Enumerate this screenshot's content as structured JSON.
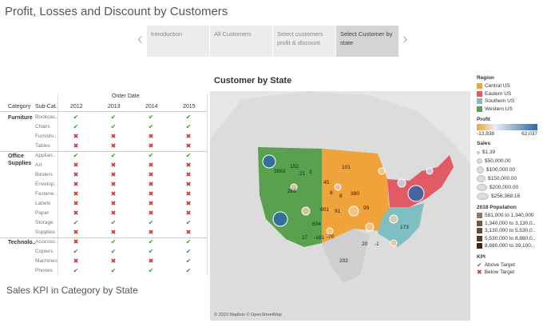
{
  "page_title": "Profit, Losses and Discount by Customers",
  "story": {
    "tabs": [
      "Introduction",
      "All Customers",
      "Select customers profit & discount",
      "Select Customer by state"
    ],
    "active_index": 3
  },
  "table": {
    "header_order_date": "Order Date",
    "col_category": "Category",
    "col_subcategory": "Sub-Cat..",
    "years": [
      "2012",
      "2013",
      "2014",
      "2015"
    ],
    "groups": [
      {
        "category": "Furniture",
        "rows": [
          {
            "sub": "Bookcas..",
            "kpi": [
              1,
              1,
              1,
              1
            ]
          },
          {
            "sub": "Chairs",
            "kpi": [
              1,
              1,
              1,
              1
            ]
          },
          {
            "sub": "Furnishi..",
            "kpi": [
              0,
              0,
              0,
              0
            ]
          },
          {
            "sub": "Tables",
            "kpi": [
              0,
              0,
              0,
              0
            ]
          }
        ]
      },
      {
        "category": "Office Supplies",
        "rows": [
          {
            "sub": "Applian..",
            "kpi": [
              1,
              1,
              1,
              1
            ]
          },
          {
            "sub": "Art",
            "kpi": [
              0,
              0,
              0,
              0
            ]
          },
          {
            "sub": "Binders",
            "kpi": [
              0,
              0,
              0,
              0
            ]
          },
          {
            "sub": "Envelop..",
            "kpi": [
              0,
              0,
              0,
              0
            ]
          },
          {
            "sub": "Fastene..",
            "kpi": [
              0,
              0,
              0,
              0
            ]
          },
          {
            "sub": "Labels",
            "kpi": [
              0,
              0,
              0,
              0
            ]
          },
          {
            "sub": "Paper",
            "kpi": [
              0,
              0,
              0,
              0
            ]
          },
          {
            "sub": "Storage",
            "kpi": [
              1,
              1,
              1,
              1
            ]
          },
          {
            "sub": "Supplies",
            "kpi": [
              0,
              0,
              0,
              0
            ]
          }
        ]
      },
      {
        "category": "Technolo..",
        "rows": [
          {
            "sub": "Accesso..",
            "kpi": [
              0,
              1,
              1,
              1
            ]
          },
          {
            "sub": "Copiers",
            "kpi": [
              1,
              1,
              1,
              1
            ]
          },
          {
            "sub": "Machines",
            "kpi": [
              0,
              0,
              0,
              1
            ]
          },
          {
            "sub": "Phones",
            "kpi": [
              1,
              1,
              1,
              1
            ]
          }
        ]
      }
    ],
    "check_icon": "check-icon",
    "cross_icon": "cross-icon"
  },
  "kpi_title": "Sales KPI in Category by State",
  "map": {
    "title": "Customer by State",
    "credit": "© 2023 Mapbox © OpenStreetMap",
    "labels": [
      "3563",
      "152",
      "21",
      "3",
      "101",
      "266",
      "45",
      "8",
      "380",
      "8",
      "-901",
      "91",
      "99",
      "634",
      "173",
      "17",
      "-181",
      "-70",
      "20",
      "-1",
      "202"
    ]
  },
  "legend": {
    "region_title": "Region",
    "regions": [
      {
        "label": "Central US",
        "color": "#f0a23b"
      },
      {
        "label": "Eastern US",
        "color": "#e15b64"
      },
      {
        "label": "Southern US",
        "color": "#7fbfc4"
      },
      {
        "label": "Western US",
        "color": "#59a14f"
      }
    ],
    "profit_title": "Profit",
    "profit_min": "-13,838",
    "profit_max": "62,037",
    "sales_title": "Sales",
    "sales": [
      "$1.39",
      "$50,000.00",
      "$100,000.00",
      "$150,000.00",
      "$200,000.00",
      "$256,368.16"
    ],
    "pop_title": "2018 Population",
    "pop": [
      {
        "label": "581,000 to 1,340,000",
        "color": "#8c7b6b"
      },
      {
        "label": "1,340,000 to 3,130,0..",
        "color": "#7a5a3c"
      },
      {
        "label": "3,130,000 to 5,530,0..",
        "color": "#6b4a2c"
      },
      {
        "label": "5,530,000 to 8,880,0..",
        "color": "#5a3a1f"
      },
      {
        "label": "8,880,000 to 39,100,..",
        "color": "#3e2712"
      }
    ],
    "kpi_title": "KPI",
    "kpi_above": "Above Target",
    "kpi_below": "Below Target"
  }
}
